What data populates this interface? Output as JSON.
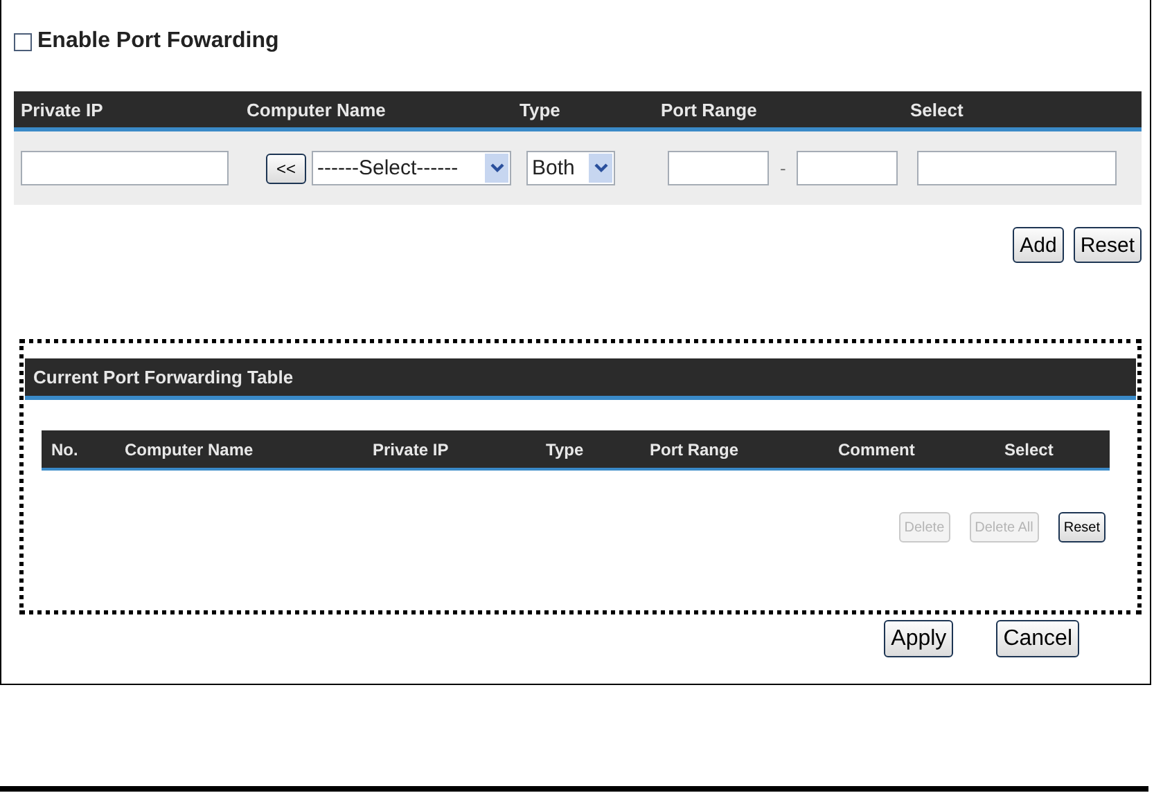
{
  "enable": {
    "label": "Enable Port Fowarding",
    "checked": false
  },
  "entry": {
    "columns": [
      "Private IP",
      "Computer Name",
      "Type",
      "Port Range",
      "Select"
    ],
    "copy_button": "<<",
    "computer_select": "------Select------",
    "type_select": "Both",
    "range_separator": "-"
  },
  "entry_buttons": [
    {
      "label": "Add",
      "disabled": false
    },
    {
      "label": "Reset",
      "disabled": false
    }
  ],
  "table": {
    "title": "Current Port Forwarding Table",
    "columns": [
      "No.",
      "Computer Name",
      "Private IP",
      "Type",
      "Port Range",
      "Comment",
      "Select"
    ]
  },
  "table_buttons": [
    {
      "label": "Delete",
      "disabled": true
    },
    {
      "label": "Delete All",
      "disabled": true
    },
    {
      "label": "Reset",
      "disabled": false
    }
  ],
  "buttons": [
    {
      "label": "Apply",
      "disabled": false
    },
    {
      "label": "Cancel",
      "disabled": false
    }
  ]
}
